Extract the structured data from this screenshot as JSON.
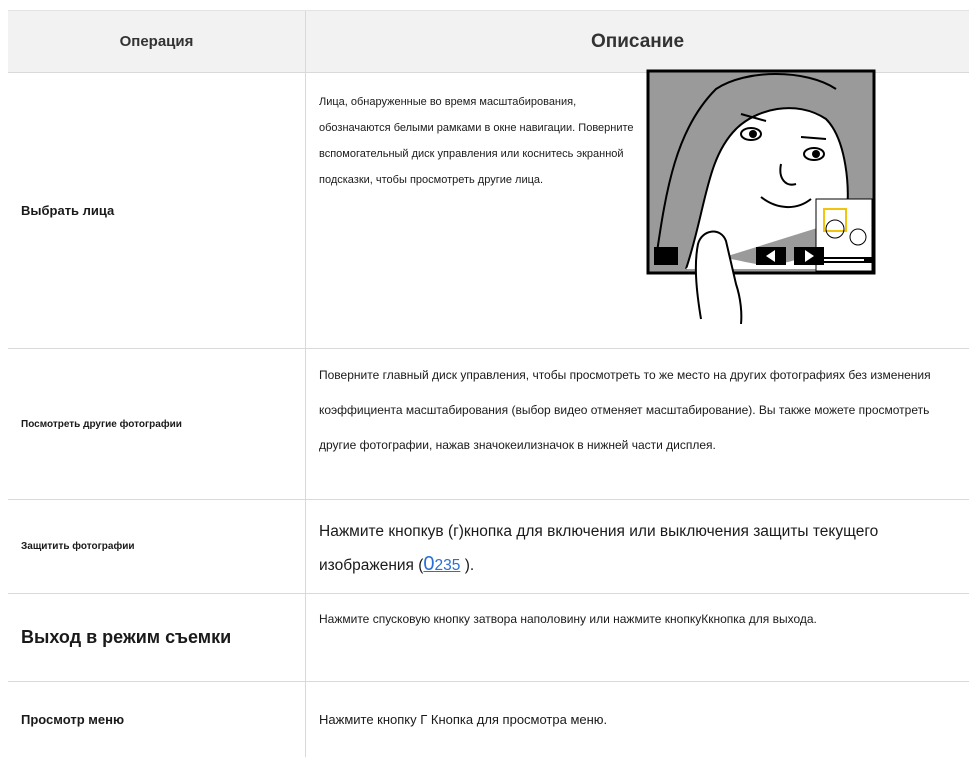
{
  "header": {
    "col_operation": "Операция",
    "col_description": "Описание"
  },
  "rows": [
    {
      "operation": "Выбрать лица",
      "description": "Лица, обнаруженные во время масштабирования, обозначаются белыми рамками в окне навигации. Поверните вспомогательный диск управления или коснитесь экранной подсказки, чтобы просмотреть другие лица."
    },
    {
      "operation": "Посмотреть другие фотографии",
      "description": "Поверните главный диск управления, чтобы просмотреть то же место на других фотографиях без изменения коэффициента масштабирования (выбор видео отменяет масштабирование). Вы также можете просмотреть другие фотографии, нажав значокеилизначок в нижней части дисплея."
    },
    {
      "operation": "Защитить фотографии",
      "description_before": "Нажмите кнопкув (г)кнопка для включения или выключения защиты текущего изображения (",
      "link_symbol": "0",
      "link_page": "235",
      "description_after": " )."
    },
    {
      "operation": "Выход в режим съемки",
      "description": "Нажмите спусковую кнопку затвора наполовину или нажмите кнопкуКкнопка для выхода."
    },
    {
      "operation": "Просмотр меню",
      "description": "Нажмите кнопку Г Кнопка для просмотра меню."
    }
  ],
  "colors": {
    "header_bg": "#f2f2f2",
    "border": "#d9d9d9",
    "link": "#2a6fd6",
    "highlight_frame": "#f1c40f"
  }
}
